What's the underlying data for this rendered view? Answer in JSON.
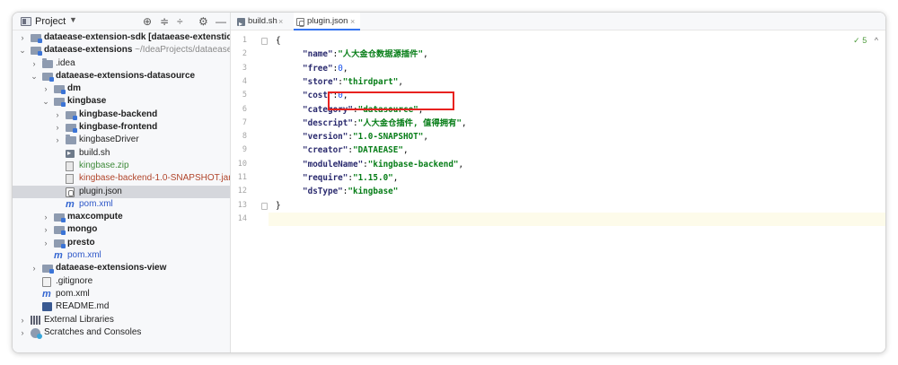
{
  "project_panel": {
    "title": "Project",
    "tree": [
      {
        "label": "dataease-extension-sdk",
        "suffix": " [dataease-extenstion-",
        "bold": true,
        "expanded": false,
        "icon": "module-icon"
      },
      {
        "label": "dataease-extensions",
        "suffix": " ~/IdeaProjects/dataease-e",
        "bold": true,
        "expanded": true,
        "icon": "module-icon"
      },
      {
        "label": ".idea",
        "expanded": false,
        "icon": "folder-icon"
      },
      {
        "label": "dataease-extensions-datasource",
        "bold": true,
        "expanded": true,
        "icon": "module-icon"
      },
      {
        "label": "dm",
        "bold": true,
        "expanded": false,
        "icon": "module-icon"
      },
      {
        "label": "kingbase",
        "bold": true,
        "expanded": true,
        "icon": "module-icon"
      },
      {
        "label": "kingbase-backend",
        "bold": true,
        "expanded": false,
        "icon": "module-icon"
      },
      {
        "label": "kingbase-frontend",
        "bold": true,
        "expanded": false,
        "icon": "module-icon"
      },
      {
        "label": "kingbaseDriver",
        "expanded": false,
        "icon": "folder-icon"
      },
      {
        "label": "build.sh",
        "icon": "script-icon"
      },
      {
        "label": "kingbase.zip",
        "icon": "archive-icon"
      },
      {
        "label": "kingbase-backend-1.0-SNAPSHOT.jar",
        "icon": "archive-icon"
      },
      {
        "label": "plugin.json",
        "icon": "json-icon",
        "selected": true
      },
      {
        "label": "pom.xml",
        "icon": "maven-icon"
      },
      {
        "label": "maxcompute",
        "bold": true,
        "expanded": false,
        "icon": "module-icon"
      },
      {
        "label": "mongo",
        "bold": true,
        "expanded": false,
        "icon": "module-icon"
      },
      {
        "label": "presto",
        "bold": true,
        "expanded": false,
        "icon": "module-icon"
      },
      {
        "label": "pom.xml",
        "icon": "maven-icon"
      },
      {
        "label": "dataease-extensions-view",
        "bold": true,
        "expanded": false,
        "icon": "module-icon"
      },
      {
        "label": ".gitignore",
        "icon": "gitignore-icon"
      },
      {
        "label": "pom.xml",
        "icon": "maven-icon"
      },
      {
        "label": "README.md",
        "icon": "markdown-icon"
      },
      {
        "label": "External Libraries",
        "expanded": false,
        "icon": "libraries-icon"
      },
      {
        "label": "Scratches and Consoles",
        "expanded": false,
        "icon": "scratches-icon"
      }
    ]
  },
  "editor": {
    "tabs": [
      {
        "label": "build.sh",
        "close": "×",
        "icon": "script-icon",
        "active": false
      },
      {
        "label": "plugin.json",
        "close": "×",
        "icon": "json-icon",
        "active": true
      }
    ],
    "inspection": {
      "mark": "✓",
      "count": "5"
    },
    "lines": [
      {
        "no": "1",
        "text": "{"
      },
      {
        "no": "2",
        "key": "\"name\"",
        "sep": ":",
        "value": "\"人大金仓数据源插件\"",
        "vtype": "string",
        "end": ","
      },
      {
        "no": "3",
        "key": "\"free\"",
        "sep": ":",
        "value": "0",
        "vtype": "number",
        "end": ","
      },
      {
        "no": "4",
        "key": "\"store\"",
        "sep": ":",
        "value": "\"thirdpart\"",
        "vtype": "string",
        "end": ","
      },
      {
        "no": "5",
        "key": "\"cost\"",
        "sep": ":",
        "value": "0",
        "vtype": "number",
        "end": ","
      },
      {
        "no": "6",
        "key": "\"category\"",
        "sep": ":",
        "value": "\"datasource\"",
        "vtype": "string",
        "end": ","
      },
      {
        "no": "7",
        "key": "\"descript\"",
        "sep": ":",
        "value": "\"人大金仓插件, 值得拥有\"",
        "vtype": "string",
        "end": ","
      },
      {
        "no": "8",
        "key": "\"version\"",
        "sep": ":",
        "value": "\"1.0-SNAPSHOT\"",
        "vtype": "string",
        "end": ","
      },
      {
        "no": "9",
        "key": "\"creator\"",
        "sep": ":",
        "value": "\"DATAEASE\"",
        "vtype": "string",
        "end": ","
      },
      {
        "no": "10",
        "key": "\"moduleName\"",
        "sep": ":",
        "value": "\"kingbase-backend\"",
        "vtype": "string",
        "end": ","
      },
      {
        "no": "11",
        "key": "\"require\"",
        "sep": ":",
        "value": "\"1.15.0\"",
        "vtype": "string",
        "end": ","
      },
      {
        "no": "12",
        "key": "\"dsType\"",
        "sep": ":",
        "value": "\"kingbase\"",
        "vtype": "string",
        "end": ""
      },
      {
        "no": "13",
        "text": "}"
      },
      {
        "no": "14",
        "text": ""
      }
    ],
    "current_line": "14",
    "highlight_color": "#e8221f"
  }
}
